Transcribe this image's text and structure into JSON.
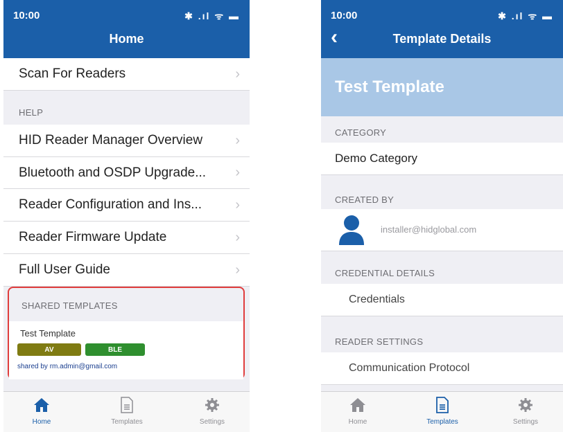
{
  "status_bar": {
    "time": "10:00",
    "icons": "✱ .ıl ᯤ ▬"
  },
  "left": {
    "title": "Home",
    "rows": [
      {
        "label": "Scan For Readers"
      }
    ],
    "help_header": "HELP",
    "help_items": [
      {
        "label": "HID Reader Manager Overview"
      },
      {
        "label": "Bluetooth and OSDP Upgrade..."
      },
      {
        "label": "Reader Configuration and Ins..."
      },
      {
        "label": "Reader Firmware Update"
      },
      {
        "label": "Full User Guide"
      }
    ],
    "shared_header": "SHARED TEMPLATES",
    "shared_template": {
      "name": "Test Template",
      "tags": [
        {
          "label": "AV",
          "color": "#7f7b12"
        },
        {
          "label": "BLE",
          "color": "#2f8f2f"
        }
      ],
      "shared_by": "shared by rm.admin@gmail.com"
    },
    "tabs": [
      {
        "label": "Home",
        "icon": "home-icon",
        "active": true
      },
      {
        "label": "Templates",
        "icon": "document-icon",
        "active": false
      },
      {
        "label": "Settings",
        "icon": "gear-icon",
        "active": false
      }
    ]
  },
  "right": {
    "title": "Template Details",
    "template_name": "Test Template",
    "category_header": "CATEGORY",
    "category_value": "Demo Category",
    "created_by_header": "CREATED BY",
    "created_by_email": "installer@hidglobal.com",
    "credential_header": "CREDENTIAL DETAILS",
    "credentials_label": "Credentials",
    "reader_settings_header": "READER SETTINGS",
    "communication_label": "Communication Protocol",
    "tabs": [
      {
        "label": "Home",
        "icon": "home-icon",
        "active": false
      },
      {
        "label": "Templates",
        "icon": "document-icon",
        "active": true
      },
      {
        "label": "Settings",
        "icon": "gear-icon",
        "active": false
      }
    ]
  },
  "colors": {
    "nav": "#1b5fa9",
    "header_band": "#a9c7e6",
    "highlight": "#e03c3c"
  }
}
